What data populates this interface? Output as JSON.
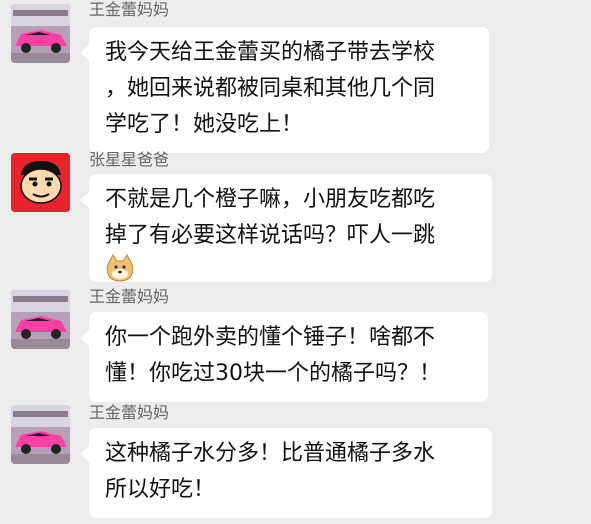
{
  "messages": [
    {
      "sender": "王金蕾妈妈",
      "avatar": "pink-sports-car-avatar",
      "lines": [
        "我今天给王金蕾买的橘子带去学校",
        "，她回来说都被同桌和其他几个同",
        "学吃了！她没吃上！"
      ]
    },
    {
      "sender": "张星星爸爸",
      "avatar": "cartoon-boy-avatar",
      "lines": [
        "不就是几个橙子嘛，小朋友吃都吃",
        "掉了有必要这样说话吗？吓人一跳"
      ],
      "emoji": "doge-emoji"
    },
    {
      "sender": "王金蕾妈妈",
      "avatar": "pink-sports-car-avatar",
      "lines": [
        "你一个跑外卖的懂个锤子！啥都不",
        "懂！你吃过30块一个的橘子吗？！"
      ]
    },
    {
      "sender": "王金蕾妈妈",
      "avatar": "pink-sports-car-avatar",
      "lines": [
        "这种橘子水分多！比普通橘子多水",
        "所以好吃！"
      ]
    }
  ]
}
